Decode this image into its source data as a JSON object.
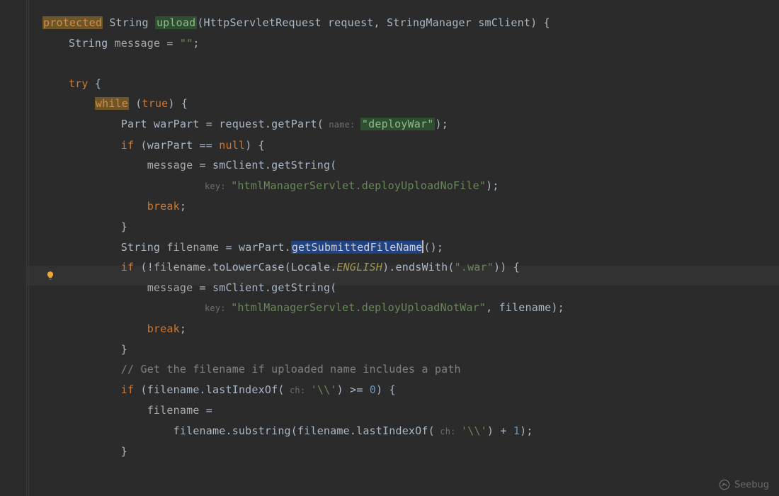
{
  "tokens": {
    "kw_protected": "protected",
    "type_string": "String",
    "method_upload": "upload",
    "sig_rest": "(HttpServletRequest request, StringManager smClient) {",
    "decl_message": "String ",
    "var_message": "message",
    "eq": " = ",
    "empty_str": "\"\"",
    "semi": ";",
    "kw_try": "try",
    "brace_open": " {",
    "kw_while": "while",
    "paren_open": " (",
    "kw_true": "true",
    "paren_brace": ") {",
    "part_decl": "Part warPart = request.getPart(",
    "hint_name": " name: ",
    "str_deployWar": "\"deployWar\"",
    "paren_semi": ");",
    "if_warpart": "if",
    "warpart_null": " (warPart == ",
    "kw_null": "null",
    "close_brace_if": ") {",
    "assign_msg": "message",
    "smclient": " = smClient.getString(",
    "hint_key": " key: ",
    "str_nofile": "\"htmlManagerServlet.deployUploadNoFile\"",
    "kw_break": "break",
    "brace_close": "}",
    "filename_decl": "String ",
    "var_filename": "filename",
    "warpart_dot": " = warPart.",
    "get_submitted": "getSubmittedFileName",
    "call_close": "();",
    "if2": "if",
    "not_open": " (!",
    "filename_lc": "filename",
    "tolower": ".toLowerCase(Locale.",
    "english": "ENGLISH",
    "endswith": ").endsWith(",
    "str_war": "\".war\"",
    "close2": ")) {",
    "str_notwar": "\"htmlManagerServlet.deployUploadNotWar\"",
    "comma_filename": ", filename);",
    "comment_path": "// Get the filename if uploaded name includes a path",
    "if3": "if",
    "last_index": " (filename.lastIndexOf(",
    "hint_ch": " ch: ",
    "char_bs": "'\\\\'",
    "ge0": ") >= ",
    "zero": "0",
    "brace3": ") {",
    "filename_eq": "filename",
    "just_eq": " =",
    "substr": "filename.substring(filename.lastIndexOf(",
    "plus1": ") + ",
    "one": "1",
    "end_semi": ");",
    "brace_close2": "}"
  },
  "watermark": "Seebug"
}
